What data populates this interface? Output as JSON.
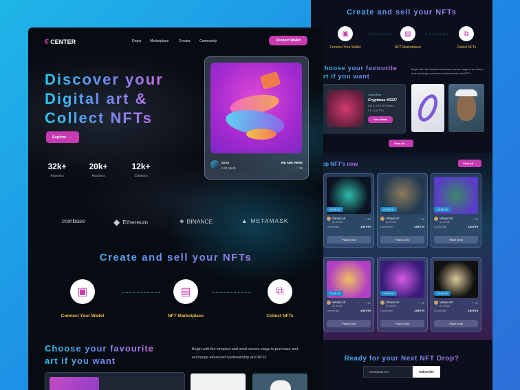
{
  "right": {
    "title": "Create and sell your NFTs",
    "steps": [
      "Connect Your Wallet",
      "NFT Marketplace",
      "Collect NFTs"
    ],
    "choose_title": "Choose your favourite art if you want",
    "choose_desc": "Begin with the simplest and most secure stage to purchase and exchange advanced workmanship and NFTs",
    "feature": {
      "tag": "CryptoMax",
      "name": "Cryptmax #5327",
      "date": "Sep 8, 2022 at 06:55pm",
      "price": "0.5 - 6.89 ETH",
      "button": "View details"
    },
    "view_all": "View All",
    "top_title": "Top NFT's now",
    "top_view_all": "View All",
    "cards": [
      {
        "time": "03:05:33",
        "name": "Virtual Art",
        "by": "By denish",
        "likes": "92",
        "label": "Current Bid",
        "price": "4.89 ETH",
        "button": "Place a bid"
      },
      {
        "time": "03:05:33",
        "name": "Virtual Art",
        "by": "By denish",
        "likes": "92",
        "label": "Current Bid",
        "price": "4.89 ETH",
        "button": "Place a bid"
      },
      {
        "time": "03:05:33",
        "name": "Virtual Art",
        "by": "By denish",
        "likes": "92",
        "label": "Current Bid",
        "price": "4.89 ETH",
        "button": "Place a bid"
      },
      {
        "time": "03:05:33",
        "name": "Virtual Art",
        "by": "By denish",
        "likes": "92",
        "label": "Current Bid",
        "price": "4.89 ETH",
        "button": "Place a bid"
      },
      {
        "time": "03:05:33",
        "name": "Virtual Art",
        "by": "By denish",
        "likes": "92",
        "label": "Current Bid",
        "price": "4.89 ETH",
        "button": "Place a bid"
      },
      {
        "time": "03:05:33",
        "name": "Virtual Art",
        "by": "By denish",
        "likes": "92",
        "label": "Current Bid",
        "price": "4.89 ETH",
        "button": "Place a bid"
      }
    ],
    "ready_title": "Ready for your Next NFT Drop?",
    "email_placeholder": "info@gmail.com",
    "subscribe": "Subscribe"
  },
  "main": {
    "logo": "CENTER",
    "nav": [
      "Drops",
      "Marketplace",
      "Creator",
      "Community"
    ],
    "connect_wallet": "Connect Wallet",
    "hero_title": [
      "Discover your",
      "Digital art &",
      "Collect NFTs"
    ],
    "explore": "Explore",
    "stats": [
      {
        "value": "32k+",
        "label": "Artworks"
      },
      {
        "value": "20k+",
        "label": "Auctions"
      },
      {
        "value": "12k+",
        "label": "Creators"
      }
    ],
    "nft_card": {
      "user": "laura",
      "price": "0.21 Weth",
      "tag": "WE ARE HERE",
      "likes": "25"
    },
    "brands": [
      "coinbase",
      "Ethereum",
      "BINANCE",
      "METAMASK"
    ],
    "section_title": "Create and sell your NFTs",
    "steps": [
      "Connect Your Wallet",
      "NFT Marketplace",
      "Collect NFTs"
    ],
    "choose_title": [
      "Choose your favourite",
      "art if you want"
    ],
    "choose_desc": "Begin with the simplest and most secure stage to purchase and exchange advanced workmanship and NFTs"
  },
  "colors": {
    "accent": "#c63bb0",
    "gold": "#f2c14b",
    "cyan": "#27c7f2",
    "bg": "#070b12"
  }
}
